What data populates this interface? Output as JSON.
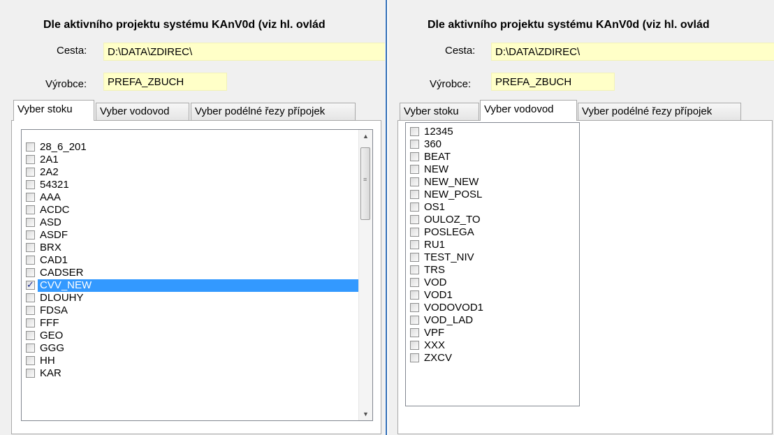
{
  "left_panel": {
    "title": "Dle aktivního projektu systému KAnV0d (viz hl. ovlád",
    "path_label": "Cesta:",
    "path_value": "D:\\DATA\\ZDIREC\\",
    "manufacturer_label": "Výrobce:",
    "manufacturer_value": "PREFA_ZBUCH",
    "tabs": [
      {
        "label": "Vyber stoku",
        "active": true
      },
      {
        "label": "Vyber vodovod",
        "active": false
      },
      {
        "label": "Vyber podélné řezy přípojek",
        "active": false
      }
    ],
    "items": [
      {
        "label": "28_6_201",
        "checked": false,
        "selected": false
      },
      {
        "label": "2A1",
        "checked": false,
        "selected": false
      },
      {
        "label": "2A2",
        "checked": false,
        "selected": false
      },
      {
        "label": "54321",
        "checked": false,
        "selected": false
      },
      {
        "label": "AAA",
        "checked": false,
        "selected": false
      },
      {
        "label": "ACDC",
        "checked": false,
        "selected": false
      },
      {
        "label": "ASD",
        "checked": false,
        "selected": false
      },
      {
        "label": "ASDF",
        "checked": false,
        "selected": false
      },
      {
        "label": "BRX",
        "checked": false,
        "selected": false
      },
      {
        "label": "CAD1",
        "checked": false,
        "selected": false
      },
      {
        "label": "CADSER",
        "checked": false,
        "selected": false
      },
      {
        "label": "CVV_NEW",
        "checked": true,
        "selected": true
      },
      {
        "label": "DLOUHY",
        "checked": false,
        "selected": false
      },
      {
        "label": "FDSA",
        "checked": false,
        "selected": false
      },
      {
        "label": "FFF",
        "checked": false,
        "selected": false
      },
      {
        "label": "GEO",
        "checked": false,
        "selected": false
      },
      {
        "label": "GGG",
        "checked": false,
        "selected": false
      },
      {
        "label": "HH",
        "checked": false,
        "selected": false
      },
      {
        "label": "KAR",
        "checked": false,
        "selected": false
      }
    ],
    "scrollbar": {
      "up_icon": "arrow-up-icon",
      "down_icon": "arrow-down-icon",
      "grip_icon": "grip-icon"
    }
  },
  "right_panel": {
    "title": "Dle aktivního projektu systému KAnV0d (viz hl. ovlád",
    "path_label": "Cesta:",
    "path_value": "D:\\DATA\\ZDIREC\\",
    "manufacturer_label": "Výrobce:",
    "manufacturer_value": "PREFA_ZBUCH",
    "tabs": [
      {
        "label": "Vyber stoku",
        "active": false
      },
      {
        "label": "Vyber vodovod",
        "active": true
      },
      {
        "label": "Vyber podélné řezy přípojek",
        "active": false
      }
    ],
    "items": [
      {
        "label": "12345",
        "checked": false,
        "selected": false
      },
      {
        "label": "360",
        "checked": false,
        "selected": false
      },
      {
        "label": "BEAT",
        "checked": false,
        "selected": false
      },
      {
        "label": "NEW",
        "checked": false,
        "selected": false
      },
      {
        "label": "NEW_NEW",
        "checked": false,
        "selected": false
      },
      {
        "label": "NEW_POSL",
        "checked": false,
        "selected": false
      },
      {
        "label": "OS1",
        "checked": false,
        "selected": false
      },
      {
        "label": "OULOZ_TO",
        "checked": false,
        "selected": false
      },
      {
        "label": "POSLEGA",
        "checked": false,
        "selected": false
      },
      {
        "label": "RU1",
        "checked": false,
        "selected": false
      },
      {
        "label": "TEST_NIV",
        "checked": false,
        "selected": false
      },
      {
        "label": "TRS",
        "checked": false,
        "selected": false
      },
      {
        "label": "VOD",
        "checked": false,
        "selected": false
      },
      {
        "label": "VOD1",
        "checked": false,
        "selected": false
      },
      {
        "label": "VODOVOD1",
        "checked": false,
        "selected": false
      },
      {
        "label": "VOD_LAD",
        "checked": false,
        "selected": false
      },
      {
        "label": "VPF",
        "checked": false,
        "selected": false
      },
      {
        "label": "XXX",
        "checked": false,
        "selected": false
      },
      {
        "label": "ZXCV",
        "checked": false,
        "selected": false
      }
    ]
  },
  "colors": {
    "field_background": "#ffffc8",
    "selection": "#3399ff",
    "divider": "#2f6db5"
  }
}
